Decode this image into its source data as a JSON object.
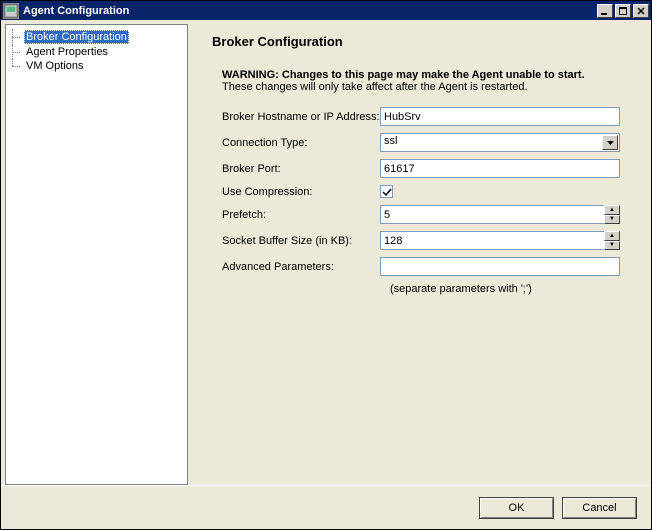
{
  "window": {
    "title": "Agent Configuration"
  },
  "sidebar": {
    "items": [
      {
        "label": "Broker Configuration",
        "selected": true
      },
      {
        "label": "Agent Properties",
        "selected": false
      },
      {
        "label": "VM Options",
        "selected": false
      }
    ]
  },
  "page": {
    "title": "Broker Configuration",
    "warning_bold": "WARNING: Changes to this page may make the Agent unable to start.",
    "warning_note": "These changes will only take affect after the Agent is restarted."
  },
  "form": {
    "broker_host_label": "Broker Hostname or IP Address:",
    "broker_host_value": "HubSrv",
    "conn_type_label": "Connection Type:",
    "conn_type_value": "ssl",
    "broker_port_label": "Broker Port:",
    "broker_port_value": "61617",
    "use_compression_label": "Use Compression:",
    "use_compression_checked": true,
    "prefetch_label": "Prefetch:",
    "prefetch_value": "5",
    "socket_buf_label": "Socket Buffer Size (in KB):",
    "socket_buf_value": "128",
    "advanced_label": "Advanced Parameters:",
    "advanced_value": "",
    "advanced_hint": "(separate parameters with ';')"
  },
  "buttons": {
    "ok": "OK",
    "cancel": "Cancel"
  }
}
